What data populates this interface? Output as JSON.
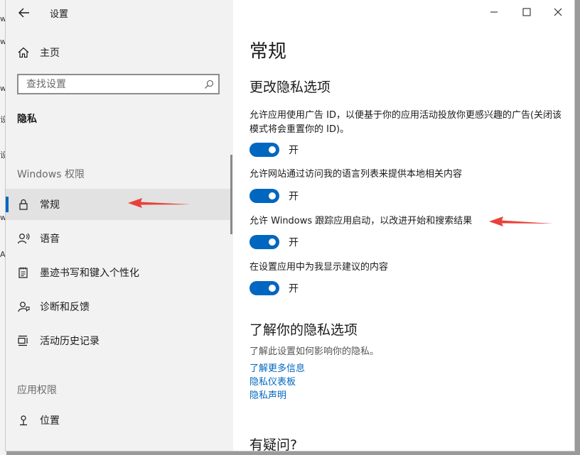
{
  "background_window": {
    "edge_fragments": [
      "w",
      "w",
      "w",
      "设",
      "设",
      "w",
      "A"
    ]
  },
  "window": {
    "title": "设置",
    "controls": {
      "minimize": "minimize-icon",
      "maximize": "maximize-icon",
      "close": "close-icon"
    }
  },
  "sidebar": {
    "home_label": "主页",
    "search": {
      "placeholder": "查找设置",
      "value": ""
    },
    "section_heading": "隐私",
    "windows_group_label": "Windows 权限",
    "windows_items": [
      {
        "label": "常规",
        "icon": "lock-icon",
        "selected": true
      },
      {
        "label": "语音",
        "icon": "speech-icon",
        "selected": false
      },
      {
        "label": "墨迹书写和键入个性化",
        "icon": "inking-icon",
        "selected": false
      },
      {
        "label": "诊断和反馈",
        "icon": "diagnostics-icon",
        "selected": false
      },
      {
        "label": "活动历史记录",
        "icon": "timeline-icon",
        "selected": false
      }
    ],
    "app_group_label": "应用权限",
    "app_items": [
      {
        "label": "位置",
        "icon": "location-icon",
        "selected": false
      }
    ]
  },
  "main": {
    "page_title": "常规",
    "privacy_section": {
      "heading": "更改隐私选项",
      "options": [
        {
          "description": "允许应用使用广告 ID，以便基于你的应用活动投放你更感兴趣的广告(关闭该模式将会重置你的 ID)。",
          "toggle_on": true,
          "state_label": "开"
        },
        {
          "description": "允许网站通过访问我的语言列表来提供本地相关内容",
          "toggle_on": true,
          "state_label": "开"
        },
        {
          "description": "允许 Windows 跟踪应用启动，以改进开始和搜索结果",
          "toggle_on": true,
          "state_label": "开"
        },
        {
          "description": "在设置应用中为我显示建议的内容",
          "toggle_on": true,
          "state_label": "开"
        }
      ]
    },
    "learn_section": {
      "heading": "了解你的隐私选项",
      "description": "了解此设置如何影响你的隐私。",
      "links": [
        "了解更多信息",
        "隐私仪表板",
        "隐私声明"
      ]
    },
    "questions_heading": "有疑问?"
  },
  "colors": {
    "accent": "#0067c0",
    "annotation_arrow": "#e8413a",
    "sidebar_bg": "#f2f2f2",
    "content_bg": "#ffffff"
  }
}
